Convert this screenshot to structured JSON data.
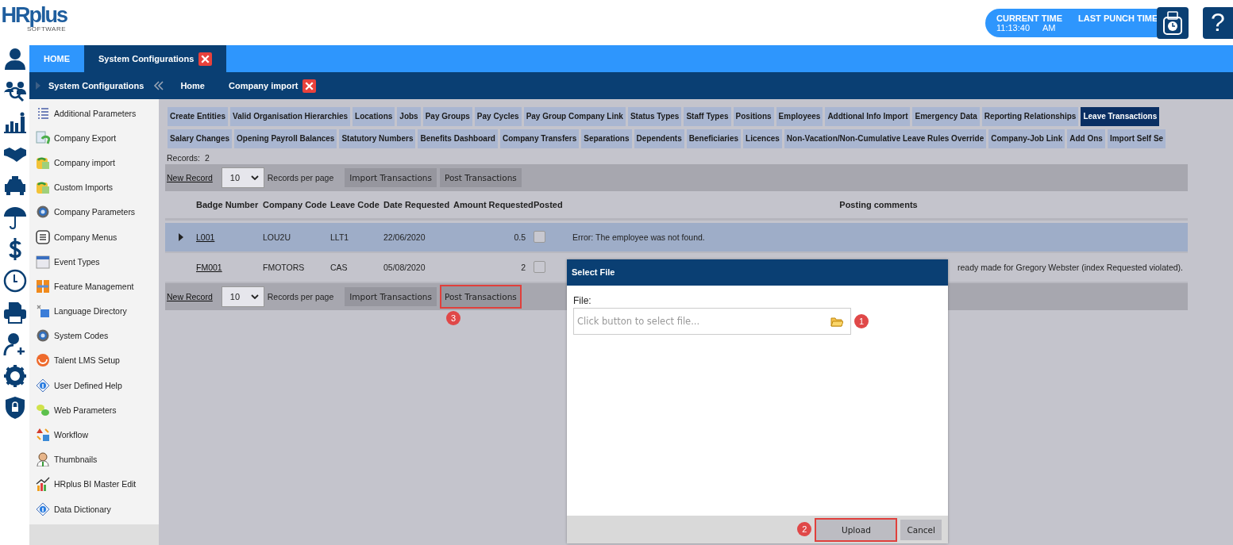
{
  "header": {
    "logo": "HRplus",
    "logo_sub": "SOFTWARE",
    "current_time_label": "CURRENT TIME",
    "current_time": "11:13:40",
    "am_pm": "AM",
    "last_punch_label": "LAST PUNCH TIME",
    "help": "?"
  },
  "top_tabs": [
    {
      "label": "HOME",
      "selected": false,
      "closable": false
    },
    {
      "label": "System Configurations",
      "selected": true,
      "closable": true
    }
  ],
  "breadcrumb": {
    "section": "System Configurations",
    "items": [
      {
        "label": "Home",
        "closable": false
      },
      {
        "label": "Company import",
        "closable": true
      }
    ]
  },
  "sidebar": {
    "items": [
      "Additional Parameters",
      "Company Export",
      "Company import",
      "Custom Imports",
      "Company Parameters",
      "Company Menus",
      "Event Types",
      "Feature Management",
      "Language Directory",
      "System Codes",
      "Talent LMS Setup",
      "User Defined Help",
      "Web Parameters",
      "Workflow",
      "Thumbnails",
      "HRplus BI Master Edit",
      "Data Dictionary"
    ]
  },
  "sub_tabs": [
    [
      {
        "label": "Create Entities",
        "selected": false
      },
      {
        "label": "Valid Organisation Hierarchies",
        "selected": false
      },
      {
        "label": "Locations",
        "selected": false
      },
      {
        "label": "Jobs",
        "selected": false
      },
      {
        "label": "Pay Groups",
        "selected": false
      },
      {
        "label": "Pay Cycles",
        "selected": false
      },
      {
        "label": "Pay Group Company Link",
        "selected": false
      },
      {
        "label": "Status Types",
        "selected": false
      },
      {
        "label": "Staff Types",
        "selected": false
      },
      {
        "label": "Positions",
        "selected": false
      },
      {
        "label": "Employees",
        "selected": false
      },
      {
        "label": "Addtional Info Import",
        "selected": false
      },
      {
        "label": "Emergency Data",
        "selected": false
      },
      {
        "label": "Reporting Relationships",
        "selected": false
      },
      {
        "label": "Leave Transactions",
        "selected": true
      }
    ],
    [
      {
        "label": "Salary Changes",
        "selected": false
      },
      {
        "label": "Opening Payroll Balances",
        "selected": false
      },
      {
        "label": "Statutory Numbers",
        "selected": false
      },
      {
        "label": "Benefits Dashboard",
        "selected": false
      },
      {
        "label": "Company Transfers",
        "selected": false
      },
      {
        "label": "Separations",
        "selected": false
      },
      {
        "label": "Dependents",
        "selected": false
      },
      {
        "label": "Beneficiaries",
        "selected": false
      },
      {
        "label": "Licences",
        "selected": false
      },
      {
        "label": "Non-Vacation/Non-Cumulative Leave Rules Override",
        "selected": false
      },
      {
        "label": "Company-Job Link",
        "selected": false
      },
      {
        "label": "Add Ons",
        "selected": false
      },
      {
        "label": "Import Self Se",
        "selected": false
      }
    ]
  ],
  "records": {
    "label": "Records:",
    "count": "2"
  },
  "toolbars": [
    {
      "new_record": "New Record",
      "page_size": "10",
      "per_page": "Records per page",
      "buttons": [
        {
          "label": "Import Transactions"
        },
        {
          "label": "Post Transactions"
        }
      ]
    },
    {
      "new_record": "New Record",
      "page_size": "10",
      "per_page": "Records per page",
      "buttons": [
        {
          "label": "Import Transactions"
        },
        {
          "label": "Post Transactions",
          "callout": "3"
        }
      ]
    }
  ],
  "table": {
    "columns": [
      "Badge Number",
      "Company Code",
      "Leave Code",
      "Date Requested",
      "Amount Requested",
      "Posted",
      "Posting comments"
    ],
    "rows": [
      {
        "badge": "L001",
        "company": "LOU2U",
        "leave": "LLT1",
        "date": "22/06/2020",
        "amount": "0.5",
        "posted": false,
        "comment": "Error: The employee was not found.",
        "selected": true,
        "expandable": true
      },
      {
        "badge": "FM001",
        "company": "FMOTORS",
        "leave": "CAS",
        "date": "05/08/2020",
        "amount": "2",
        "posted": false,
        "comment": "ready made for Gregory Webster (index Requested violated).",
        "selected": false,
        "expandable": false
      }
    ]
  },
  "dialog": {
    "title": "Select File",
    "field_label": "File:",
    "placeholder": "Click button to select file...",
    "field_callout": "1",
    "buttons": [
      {
        "label": "Upload",
        "callout": "2"
      },
      {
        "label": "Cancel"
      }
    ]
  }
}
